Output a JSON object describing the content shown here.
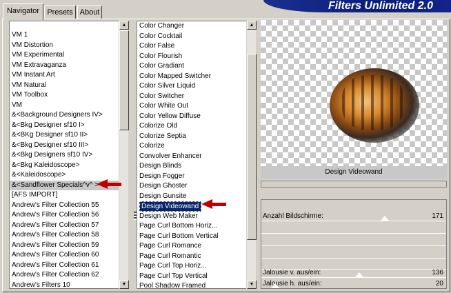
{
  "tabs": [
    {
      "label": "Navigator",
      "active": true
    },
    {
      "label": "Presets",
      "active": false
    },
    {
      "label": "About",
      "active": false
    }
  ],
  "logo": "Filters Unlimited 2.0",
  "categories": {
    "items": [
      "VM 1",
      "VM Distortion",
      "VM Experimental",
      "VM Extravaganza",
      "VM Instant Art",
      "VM Natural",
      "VM Toolbox",
      "VM",
      "&<Background Designers IV>",
      "&<Bkg Designer sf10 I>",
      "&<BKg Designer sf10 II>",
      "&<Bkg Designer sf10 III>",
      "&<Bkg Designers sf10 IV>",
      "&<Bkg Kaleidoscope>",
      "&<Kaleidoscope>",
      "&<Sandflower Specials^v^ >",
      "[AFS IMPORT]",
      "Andrew's Filter Collection 55",
      "Andrew's Filter Collection 56",
      "Andrew's Filter Collection 57",
      "Andrew's Filter Collection 58",
      "Andrew's Filter Collection 59",
      "Andrew's Filter Collection 60",
      "Andrew's Filter Collection 61",
      "Andrew's Filter Collection 62",
      "Andrew's Filters 10"
    ],
    "highlighted_index": 15
  },
  "filters": {
    "items": [
      "Color Changer",
      "Color Cocktail",
      "Color False",
      "Color Flourish",
      "Color Gradiant",
      "Color Mapped Switcher",
      "Color Silver Liquid",
      "Color Switcher",
      "Color White Out",
      "Color Yellow Diffuse",
      "Colorize Old",
      "Colorize Septia",
      "Colorize",
      "Convolver Enhancer",
      "Design Blinds",
      "Design Fogger",
      "Design Ghoster",
      "Design Gunsite",
      "Design Videowand",
      "Design Web Maker",
      "Page Curl Bottom Horiz...",
      "Page Curl Bottom Vertical",
      "Page Curl Romance",
      "Page Curl Romantic",
      "Page Curl Top Horiz...",
      "Page Curl Top Vertical",
      "Pool Shadow Framed"
    ],
    "selected_index": 18
  },
  "preview": {
    "filter_name": "Design Videowand"
  },
  "params": [
    {
      "label": "Anzahl Bildschirme:",
      "value": "171"
    },
    {
      "label": "",
      "value": ""
    },
    {
      "label": "",
      "value": ""
    },
    {
      "label": "",
      "value": ""
    },
    {
      "label": "",
      "value": ""
    },
    {
      "label": "Jalousie v. aus/ein:",
      "value": "136"
    },
    {
      "label": "Jalousie h. aus/ein:",
      "value": "20"
    }
  ],
  "colors": {
    "selection": "#0a246a",
    "arrow": "#c00000",
    "logo_bg": "#0c1e7a"
  }
}
